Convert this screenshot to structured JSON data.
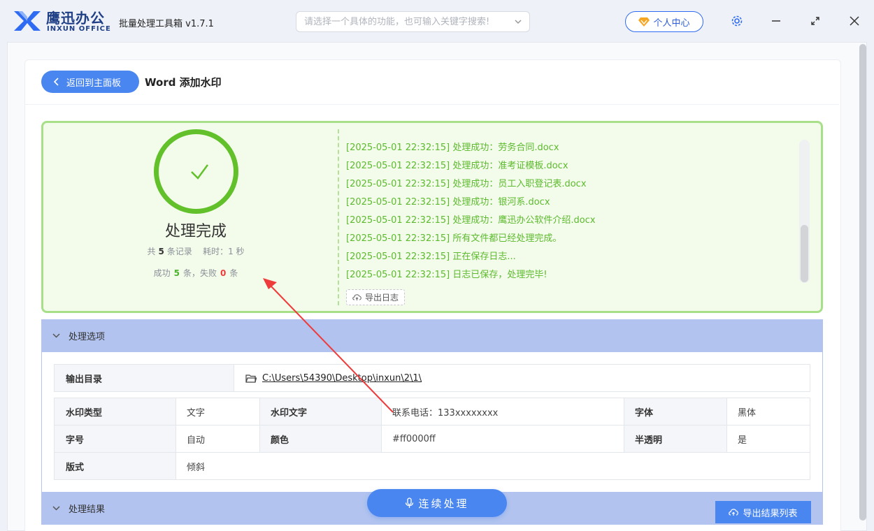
{
  "app": {
    "brand_cn": "鹰迅办公",
    "brand_en": "INXUN OFFICE",
    "title": "批量处理工具箱 v1.7.1",
    "colors": {
      "primary": "#4a86f0",
      "brand": "#1f3f86",
      "success": "#62c12b",
      "fail": "#ee3b3b",
      "section": "#b1c3ee"
    }
  },
  "search": {
    "placeholder": "请选择一个具体的功能，也可输入关键字搜索!"
  },
  "header": {
    "user_center": "个人中心"
  },
  "page": {
    "back_label": "返回到主面板",
    "title": "Word 添加水印"
  },
  "result": {
    "title": "处理完成",
    "total_prefix": "共",
    "total": "5",
    "total_suffix": "条记录",
    "time_prefix": "耗时：",
    "time": "1 秒",
    "success_prefix": "成功",
    "success": "5",
    "success_suffix": "条，失败",
    "fail": "0",
    "fail_suffix": "条",
    "export_log": "导出日志",
    "logs": [
      "[2025-05-01 22:32:15] 处理成功：劳务合同.docx",
      "[2025-05-01 22:32:15] 处理成功：准考证模板.docx",
      "[2025-05-01 22:32:15] 处理成功：员工入职登记表.docx",
      "[2025-05-01 22:32:15] 处理成功：银河系.docx",
      "[2025-05-01 22:32:15] 处理成功：鹰迅办公软件介绍.docx",
      "[2025-05-01 22:32:15] 所有文件都已经处理完成。",
      "[2025-05-01 22:32:15] 正在保存日志...",
      "[2025-05-01 22:32:15] 日志已保存，处理完毕!"
    ]
  },
  "options": {
    "section_title": "处理选项",
    "output_dir_label": "输出目录",
    "output_dir": "C:\\Users\\54390\\Desktop\\inxun\\2\\1\\",
    "wm_type_label": "水印类型",
    "wm_type": "文字",
    "wm_text_label": "水印文字",
    "wm_text": "联系电话：133xxxxxxxx",
    "font_label": "字体",
    "font": "黑体",
    "size_label": "字号",
    "size": "自动",
    "color_label": "颜色",
    "color": "#ff0000ff",
    "alpha_label": "半透明",
    "alpha": "是",
    "layout_label": "版式",
    "layout": "倾斜"
  },
  "results_section": {
    "title": "处理结果",
    "export_label": "导出结果列表"
  },
  "actions": {
    "continue_label": "连续处理"
  }
}
